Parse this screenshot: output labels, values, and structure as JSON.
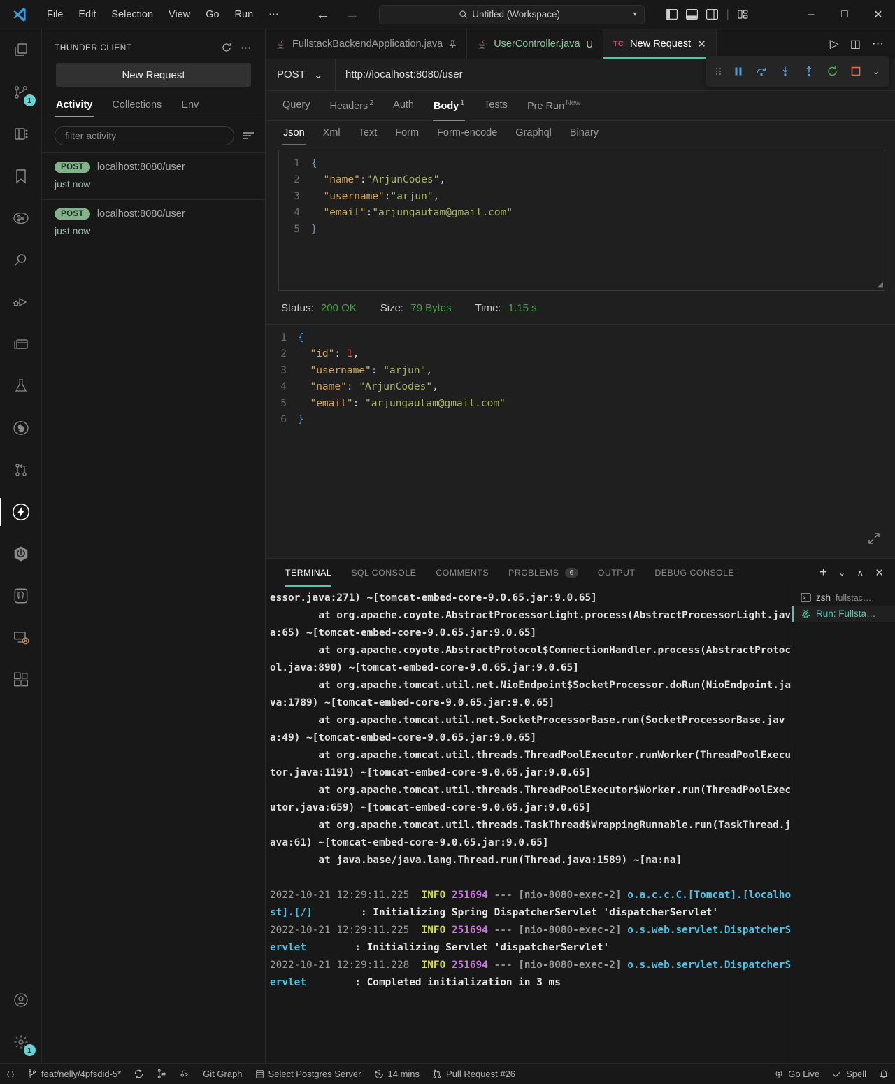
{
  "titlebar": {
    "menus": [
      "File",
      "Edit",
      "Selection",
      "View",
      "Go",
      "Run",
      "⋯"
    ],
    "command_center": "Untitled (Workspace)",
    "back_icon": "arrow-left-icon",
    "forward_icon": "arrow-right-icon",
    "window_minimize": "–",
    "window_maximize": "□",
    "window_close": "✕"
  },
  "activitybar": {
    "items": [
      {
        "name": "explorer",
        "icon": "files-icon",
        "badge": ""
      },
      {
        "name": "source-control",
        "icon": "source-control-icon",
        "badge": "1"
      },
      {
        "name": "notebook",
        "icon": "notebook-icon",
        "badge": ""
      },
      {
        "name": "bookmarks",
        "icon": "bookmark-icon",
        "badge": ""
      },
      {
        "name": "project-manager",
        "icon": "project-graph-icon",
        "badge": ""
      },
      {
        "name": "search",
        "icon": "search-icon",
        "badge": ""
      },
      {
        "name": "run-and-debug",
        "icon": "run-debug-icon",
        "badge": ""
      },
      {
        "name": "layouts",
        "icon": "window-layout-icon",
        "badge": ""
      },
      {
        "name": "testing",
        "icon": "beaker-icon",
        "badge": ""
      },
      {
        "name": "github",
        "icon": "github-icon",
        "badge": ""
      },
      {
        "name": "pull-requests",
        "icon": "pull-request-icon",
        "badge": ""
      },
      {
        "name": "thunder-client",
        "icon": "thunder-bolt-icon",
        "badge": "",
        "active": true
      },
      {
        "name": "spring-boot",
        "icon": "spring-boot-icon",
        "badge": ""
      },
      {
        "name": "postgres",
        "icon": "postgres-elephant-icon",
        "badge": ""
      },
      {
        "name": "remote-explorer",
        "icon": "remote-explorer-icon",
        "badge": ""
      },
      {
        "name": "extensions",
        "icon": "extensions-icon",
        "badge": ""
      }
    ],
    "bottom": [
      {
        "name": "accounts",
        "icon": "account-icon",
        "badge": ""
      },
      {
        "name": "settings",
        "icon": "gear-icon",
        "badge": "1"
      }
    ]
  },
  "sidebar": {
    "title": "THUNDER CLIENT",
    "refresh_icon": "refresh-icon",
    "more_icon": "more-actions-icon",
    "new_request_label": "New Request",
    "tabs": [
      {
        "label": "Activity",
        "active": true
      },
      {
        "label": "Collections",
        "active": false
      },
      {
        "label": "Env",
        "active": false
      }
    ],
    "filter_placeholder": "filter activity",
    "filter_value": "",
    "sort_icon": "sort-icon",
    "activity": [
      {
        "method": "POST",
        "url": "localhost:8080/user",
        "time": "just now"
      },
      {
        "method": "POST",
        "url": "localhost:8080/user",
        "time": "just now"
      }
    ]
  },
  "editor": {
    "tabs": [
      {
        "label": "FullstackBackendApplication.java",
        "icon": "java-icon",
        "state": "pinned",
        "state_glyph": "📌",
        "active": false
      },
      {
        "label": "UserController.java",
        "icon": "java-icon",
        "state": "unsaved",
        "state_glyph": "U",
        "active": false
      },
      {
        "label": "New Request",
        "icon": "thunder-client-icon",
        "icon_text": "TC",
        "state": "close",
        "state_glyph": "✕",
        "active": true
      }
    ],
    "actions": [
      {
        "name": "run-button",
        "glyph": "▷"
      },
      {
        "name": "split-editor-button",
        "glyph": "◫"
      },
      {
        "name": "more-actions-button",
        "glyph": "⋯"
      }
    ]
  },
  "debug_toolbar": {
    "grip_icon": "drag-grip-icon",
    "buttons": [
      {
        "name": "pause-button",
        "glyph": "⏸",
        "color": "#569cd6"
      },
      {
        "name": "step-over-button",
        "glyph": "step-over",
        "color": "#569cd6"
      },
      {
        "name": "step-into-button",
        "glyph": "step-into",
        "color": "#569cd6"
      },
      {
        "name": "step-out-button",
        "glyph": "step-out",
        "color": "#569cd6"
      },
      {
        "name": "restart-button",
        "glyph": "restart",
        "color": "#49a94e"
      },
      {
        "name": "stop-button",
        "glyph": "stop",
        "color": "#e06c5a"
      },
      {
        "name": "more-debug-button",
        "glyph": "⌄",
        "color": "#cccccc"
      }
    ]
  },
  "request": {
    "method": "POST",
    "method_caret": "⌄",
    "url": "http://localhost:8080/user",
    "tabs": [
      {
        "label": "Query",
        "sup": "",
        "active": false
      },
      {
        "label": "Headers",
        "sup": "2",
        "active": false
      },
      {
        "label": "Auth",
        "sup": "",
        "active": false
      },
      {
        "label": "Body",
        "sup": "1",
        "active": true
      },
      {
        "label": "Tests",
        "sup": "",
        "active": false
      },
      {
        "label": "Pre Run",
        "sup": "New",
        "active": false
      }
    ],
    "body_tabs": [
      {
        "label": "Json",
        "active": true
      },
      {
        "label": "Xml",
        "active": false
      },
      {
        "label": "Text",
        "active": false
      },
      {
        "label": "Form",
        "active": false
      },
      {
        "label": "Form-encode",
        "active": false
      },
      {
        "label": "Graphql",
        "active": false
      },
      {
        "label": "Binary",
        "active": false
      }
    ],
    "body_lines": [
      {
        "n": "1",
        "tokens": [
          {
            "t": "{",
            "c": "k-brace"
          }
        ]
      },
      {
        "n": "2",
        "tokens": [
          {
            "t": "  ",
            "c": "k-punc"
          },
          {
            "t": "\"name\"",
            "c": "k-key"
          },
          {
            "t": ":",
            "c": "k-punc"
          },
          {
            "t": "\"ArjunCodes\"",
            "c": "k-str"
          },
          {
            "t": ",",
            "c": "k-punc"
          }
        ]
      },
      {
        "n": "3",
        "tokens": [
          {
            "t": "  ",
            "c": "k-punc"
          },
          {
            "t": "\"username\"",
            "c": "k-key"
          },
          {
            "t": ":",
            "c": "k-punc"
          },
          {
            "t": "\"arjun\"",
            "c": "k-str"
          },
          {
            "t": ",",
            "c": "k-punc"
          }
        ]
      },
      {
        "n": "4",
        "tokens": [
          {
            "t": "  ",
            "c": "k-punc"
          },
          {
            "t": "\"email\"",
            "c": "k-key"
          },
          {
            "t": ":",
            "c": "k-punc"
          },
          {
            "t": "\"arjungautam@gmail.com\"",
            "c": "k-str"
          }
        ]
      },
      {
        "n": "5",
        "tokens": [
          {
            "t": "}",
            "c": "k-brace"
          }
        ]
      }
    ]
  },
  "response": {
    "status_label": "Status:",
    "status_value": "200 OK",
    "size_label": "Size:",
    "size_value": "79 Bytes",
    "time_label": "Time:",
    "time_value": "1.15 s",
    "expand_icon": "expand-icon",
    "lines": [
      {
        "n": "1",
        "tokens": [
          {
            "t": "{",
            "c": "k-brace"
          }
        ]
      },
      {
        "n": "2",
        "tokens": [
          {
            "t": "  ",
            "c": "k-punc"
          },
          {
            "t": "\"id\"",
            "c": "k-key"
          },
          {
            "t": ": ",
            "c": "k-punc"
          },
          {
            "t": "1",
            "c": "k-num"
          },
          {
            "t": ",",
            "c": "k-punc"
          }
        ]
      },
      {
        "n": "3",
        "tokens": [
          {
            "t": "  ",
            "c": "k-punc"
          },
          {
            "t": "\"username\"",
            "c": "k-key"
          },
          {
            "t": ": ",
            "c": "k-punc"
          },
          {
            "t": "\"arjun\"",
            "c": "k-str"
          },
          {
            "t": ",",
            "c": "k-punc"
          }
        ]
      },
      {
        "n": "4",
        "tokens": [
          {
            "t": "  ",
            "c": "k-punc"
          },
          {
            "t": "\"name\"",
            "c": "k-key"
          },
          {
            "t": ": ",
            "c": "k-punc"
          },
          {
            "t": "\"ArjunCodes\"",
            "c": "k-str"
          },
          {
            "t": ",",
            "c": "k-punc"
          }
        ]
      },
      {
        "n": "5",
        "tokens": [
          {
            "t": "  ",
            "c": "k-punc"
          },
          {
            "t": "\"email\"",
            "c": "k-key"
          },
          {
            "t": ": ",
            "c": "k-punc"
          },
          {
            "t": "\"arjungautam@gmail.com\"",
            "c": "k-str"
          }
        ]
      },
      {
        "n": "6",
        "tokens": [
          {
            "t": "}",
            "c": "k-brace"
          }
        ]
      }
    ]
  },
  "panel": {
    "tabs": [
      {
        "label": "TERMINAL",
        "badge": "",
        "active": true
      },
      {
        "label": "SQL CONSOLE",
        "badge": "",
        "active": false
      },
      {
        "label": "COMMENTS",
        "badge": "",
        "active": false
      },
      {
        "label": "PROBLEMS",
        "badge": "6",
        "active": false
      },
      {
        "label": "OUTPUT",
        "badge": "",
        "active": false
      },
      {
        "label": "DEBUG CONSOLE",
        "badge": "",
        "active": false
      }
    ],
    "actions": [
      {
        "name": "new-terminal-button",
        "glyph": "+"
      },
      {
        "name": "terminal-dropdown-button",
        "glyph": "⌄"
      },
      {
        "name": "maximize-panel-button",
        "glyph": "∧"
      },
      {
        "name": "close-panel-button",
        "glyph": "✕"
      }
    ],
    "terminals": [
      {
        "icon": "terminal-icon",
        "name": "zsh",
        "sub": "fullstac…",
        "active": false
      },
      {
        "icon": "debug-console-icon",
        "name": "Run: Fullsta…",
        "sub": "",
        "active": true
      }
    ],
    "terminal_trace": [
      "essor.java:271) ~[tomcat-embed-core-9.0.65.jar:9.0.65]",
      "        at org.apache.coyote.AbstractProcessorLight.process(AbstractProcessorLight.java:65) ~[tomcat-embed-core-9.0.65.jar:9.0.65]",
      "        at org.apache.coyote.AbstractProtocol$ConnectionHandler.process(AbstractProtocol.java:890) ~[tomcat-embed-core-9.0.65.jar:9.0.65]",
      "        at org.apache.tomcat.util.net.NioEndpoint$SocketProcessor.doRun(NioEndpoint.java:1789) ~[tomcat-embed-core-9.0.65.jar:9.0.65]",
      "        at org.apache.tomcat.util.net.SocketProcessorBase.run(SocketProcessorBase.java:49) ~[tomcat-embed-core-9.0.65.jar:9.0.65]",
      "        at org.apache.tomcat.util.threads.ThreadPoolExecutor.runWorker(ThreadPoolExecutor.java:1191) ~[tomcat-embed-core-9.0.65.jar:9.0.65]",
      "        at org.apache.tomcat.util.threads.ThreadPoolExecutor$Worker.run(ThreadPoolExecutor.java:659) ~[tomcat-embed-core-9.0.65.jar:9.0.65]",
      "        at org.apache.tomcat.util.threads.TaskThread$WrappingRunnable.run(TaskThread.java:61) ~[tomcat-embed-core-9.0.65.jar:9.0.65]",
      "        at java.base/java.lang.Thread.run(Thread.java:1589) ~[na:na]"
    ],
    "terminal_logs": [
      {
        "ts": "2022-10-21 12:29:11.225",
        "level": "INFO",
        "pid": "251694",
        "sep": "---",
        "thread": "[nio-8080-exec-2]",
        "logger": "o.a.c.c.C.[Tomcat].[localhost].[/]",
        "colon": ":",
        "msg": "Initializing Spring DispatcherServlet 'dispatcherServlet'"
      },
      {
        "ts": "2022-10-21 12:29:11.225",
        "level": "INFO",
        "pid": "251694",
        "sep": "---",
        "thread": "[nio-8080-exec-2]",
        "logger": "o.s.web.servlet.DispatcherServlet",
        "colon": ":",
        "msg": "Initializing Servlet 'dispatcherServlet'"
      },
      {
        "ts": "2022-10-21 12:29:11.228",
        "level": "INFO",
        "pid": "251694",
        "sep": "---",
        "thread": "[nio-8080-exec-2]",
        "logger": "o.s.web.servlet.DispatcherServlet",
        "colon": ":",
        "msg": "Completed initialization in 3 ms"
      }
    ]
  },
  "statusbar": {
    "left": [
      {
        "name": "remote-indicator",
        "icon": "remote-icon",
        "label": ""
      },
      {
        "name": "git-branch",
        "icon": "git-branch-icon",
        "label": "feat/nelly/4pfsdid-5*"
      },
      {
        "name": "sync-changes",
        "icon": "sync-icon",
        "label": ""
      },
      {
        "name": "git-compare",
        "icon": "git-compare-icon",
        "label": ""
      },
      {
        "name": "git-publish",
        "icon": "git-publish-icon",
        "label": ""
      },
      {
        "name": "git-graph",
        "icon": "",
        "label": "Git Graph"
      },
      {
        "name": "select-postgres-server",
        "icon": "database-icon",
        "label": "Select Postgres Server"
      },
      {
        "name": "wakatime",
        "icon": "clock-icon",
        "label": "14 mins"
      },
      {
        "name": "pull-request",
        "icon": "pull-request-icon",
        "label": "Pull Request #26"
      }
    ],
    "right": [
      {
        "name": "go-live",
        "icon": "broadcast-icon",
        "label": "Go Live"
      },
      {
        "name": "spell-checker",
        "icon": "check-icon",
        "label": "Spell"
      },
      {
        "name": "notifications",
        "icon": "bell-icon",
        "label": ""
      }
    ]
  },
  "colors": {
    "accent_teal": "#4ec9b0",
    "badge_teal": "#62d4d4",
    "status_green": "#3ea647",
    "method_green": "#84b38b",
    "json_key": "#d8a657",
    "json_string": "#a9b665",
    "json_number": "#ea6962",
    "json_brace": "#569cd6",
    "log_info": "#d7e04a",
    "log_pid": "#c678dd",
    "log_logger": "#4fc1e9"
  }
}
